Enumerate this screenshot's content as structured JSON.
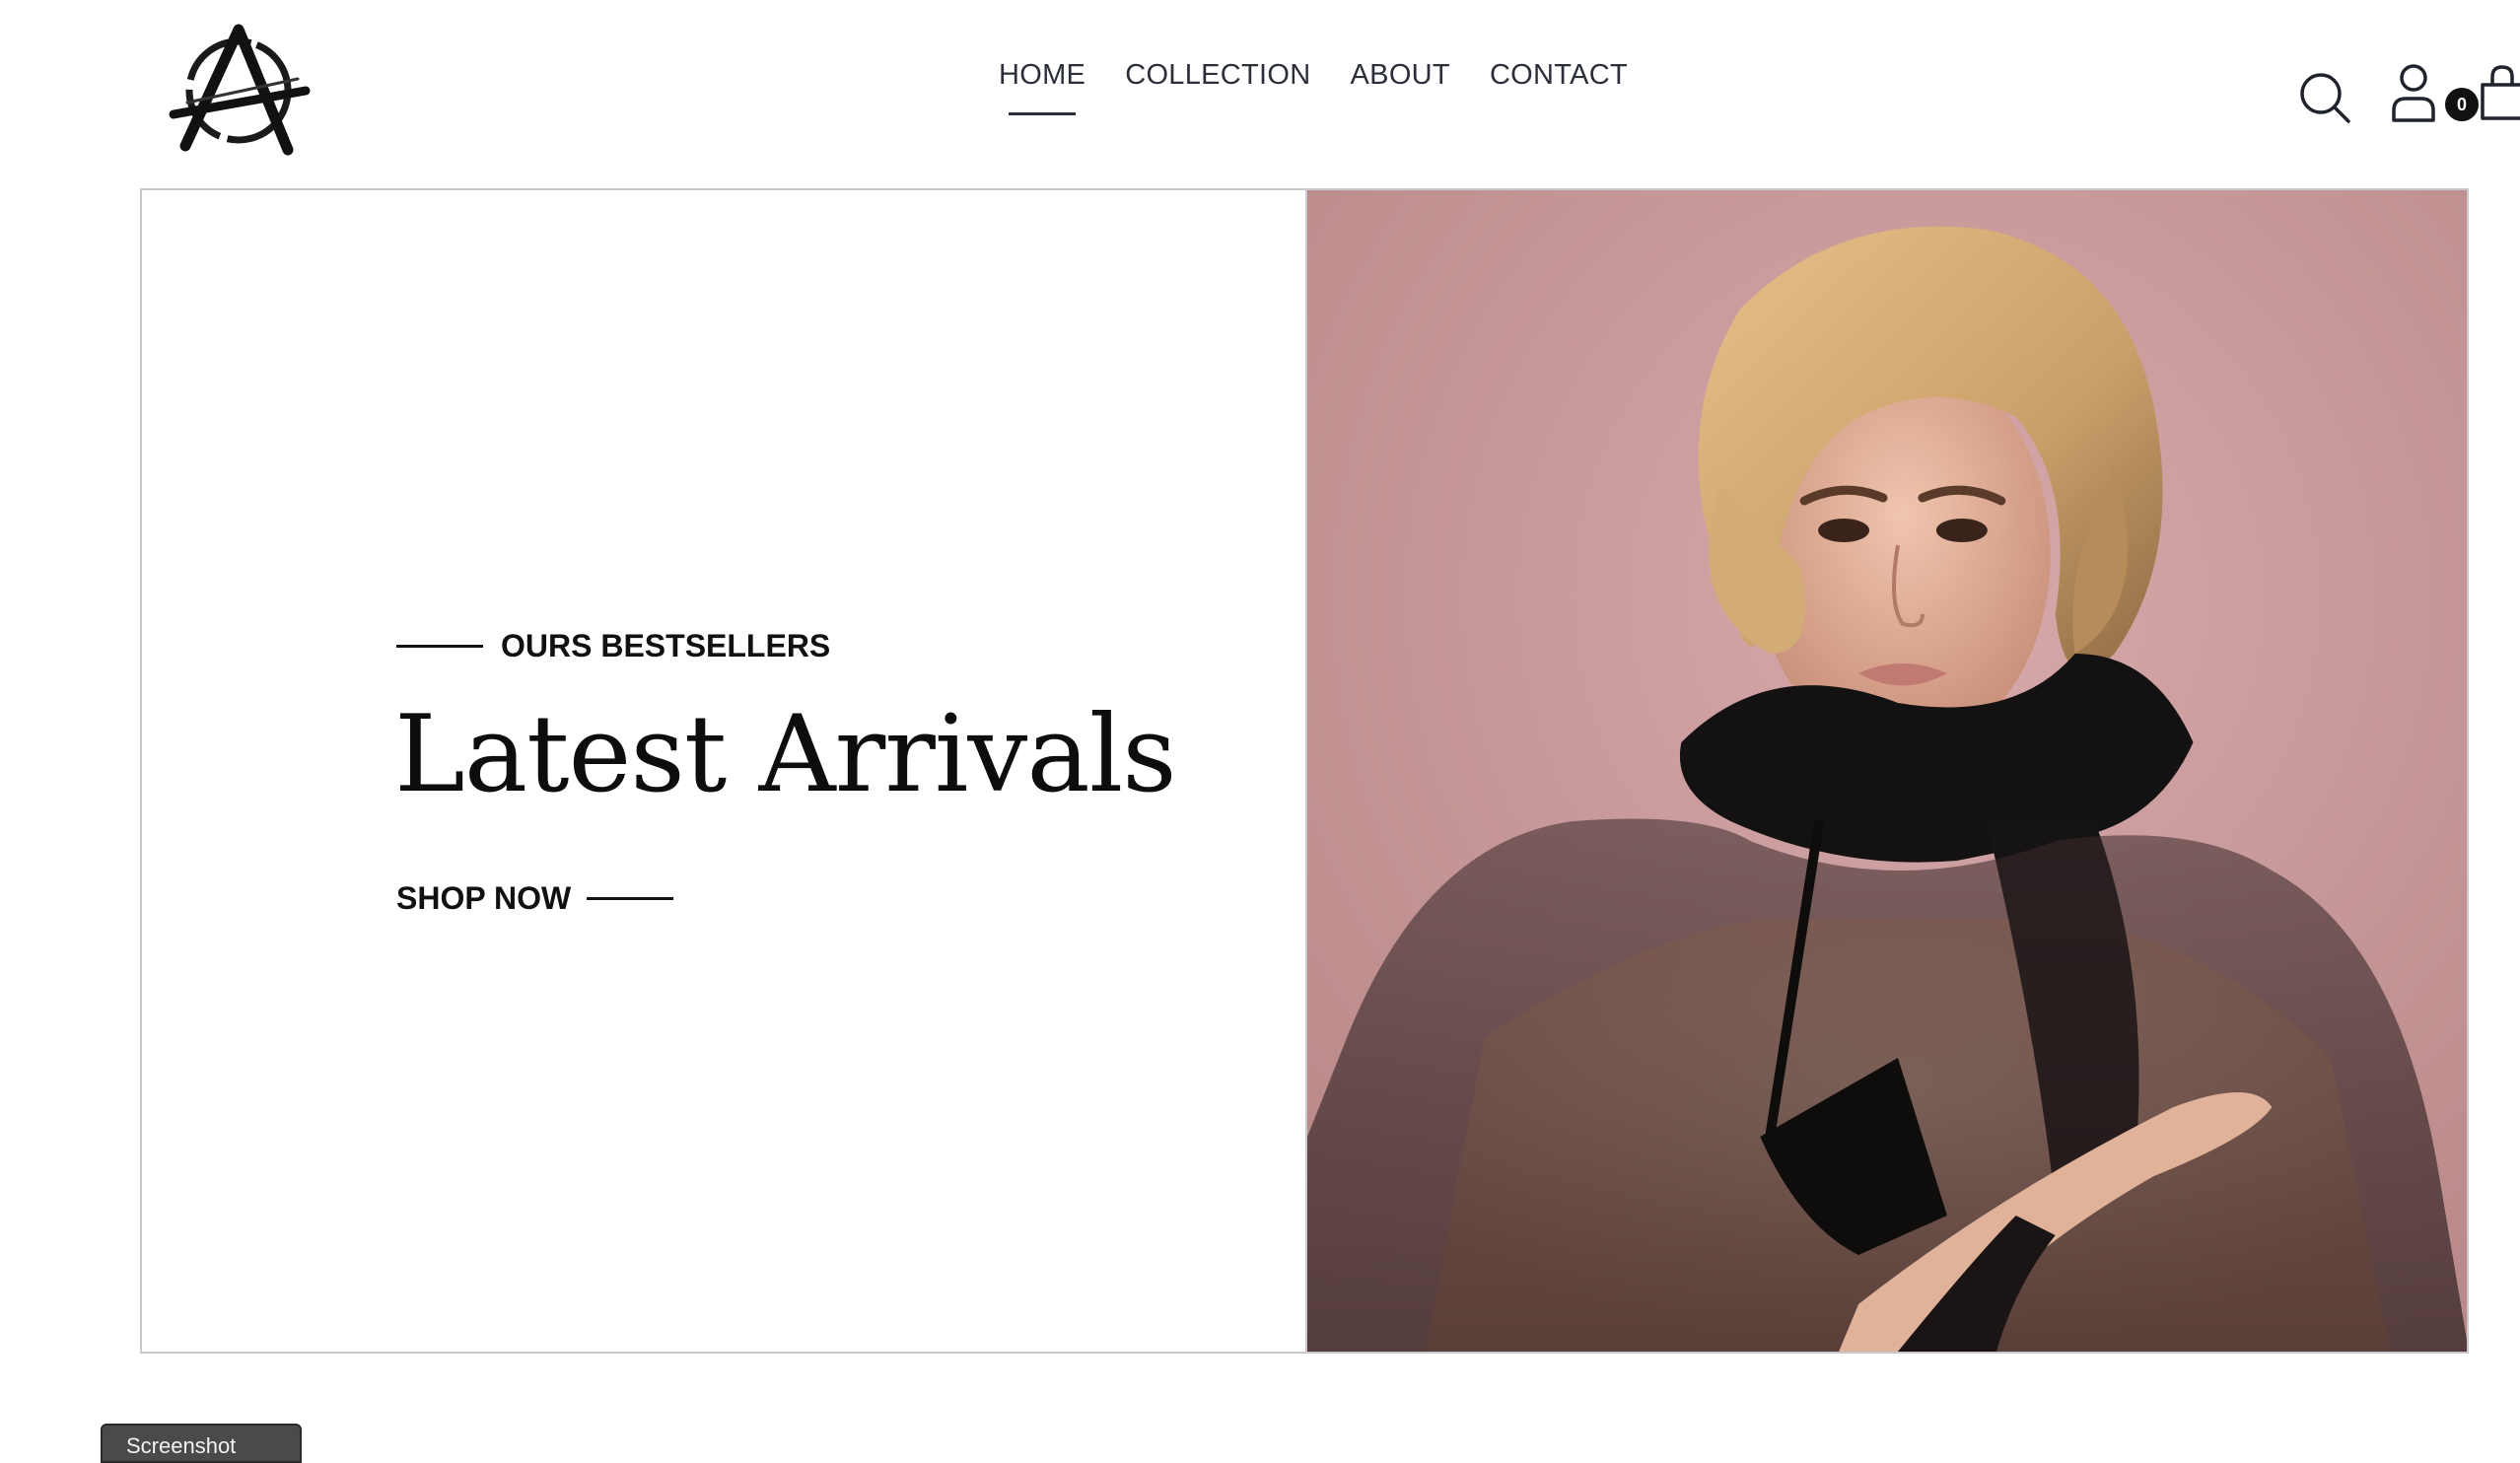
{
  "header": {
    "logo_icon": "anarchy-a-logo-icon",
    "nav": [
      {
        "label": "HOME",
        "active": true
      },
      {
        "label": "COLLECTION",
        "active": false
      },
      {
        "label": "ABOUT",
        "active": false
      },
      {
        "label": "CONTACT",
        "active": false
      }
    ],
    "icons": [
      "search-icon",
      "account-icon",
      "shopping-bag-icon"
    ],
    "cart_count": "0"
  },
  "hero": {
    "eyebrow": "OURS BESTSELLERS",
    "title": "Latest Arrivals",
    "cta": "SHOP NOW",
    "image_icon": "model-photo",
    "colors": {
      "background": "#c89a9c",
      "text": "#111111"
    }
  },
  "footer_tab": {
    "label": "Screenshot"
  }
}
